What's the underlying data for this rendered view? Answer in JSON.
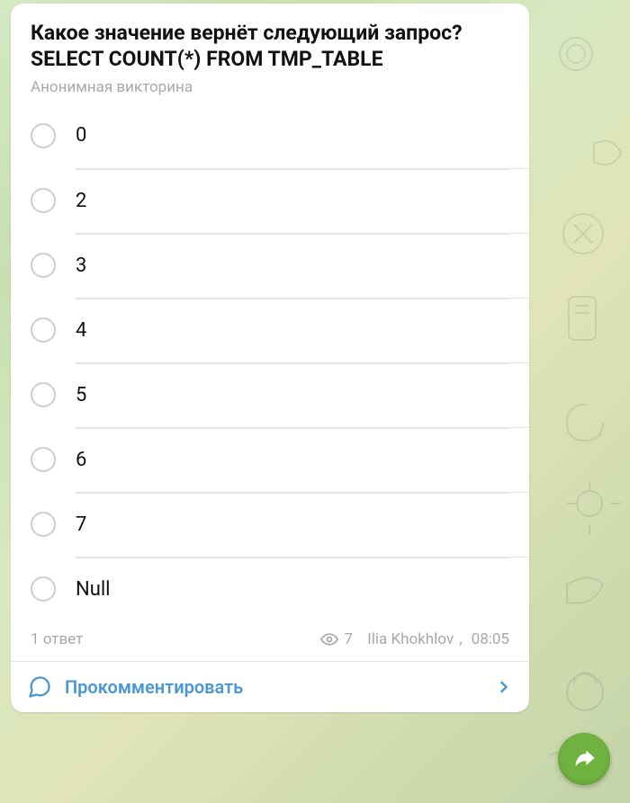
{
  "poll": {
    "question_line1": "Какое значение вернёт следующий запрос?",
    "question_line2": "SELECT COUNT(*)  FROM  TMP_TABLE",
    "subtitle": "Анонимная викторина",
    "options": [
      "0",
      "2",
      "3",
      "4",
      "5",
      "6",
      "7",
      "Null"
    ],
    "answers_label": "1 ответ",
    "views": "7",
    "author": "Ilia Khokhlov",
    "time": "08:05"
  },
  "comment": {
    "label": "Прокомментировать"
  }
}
